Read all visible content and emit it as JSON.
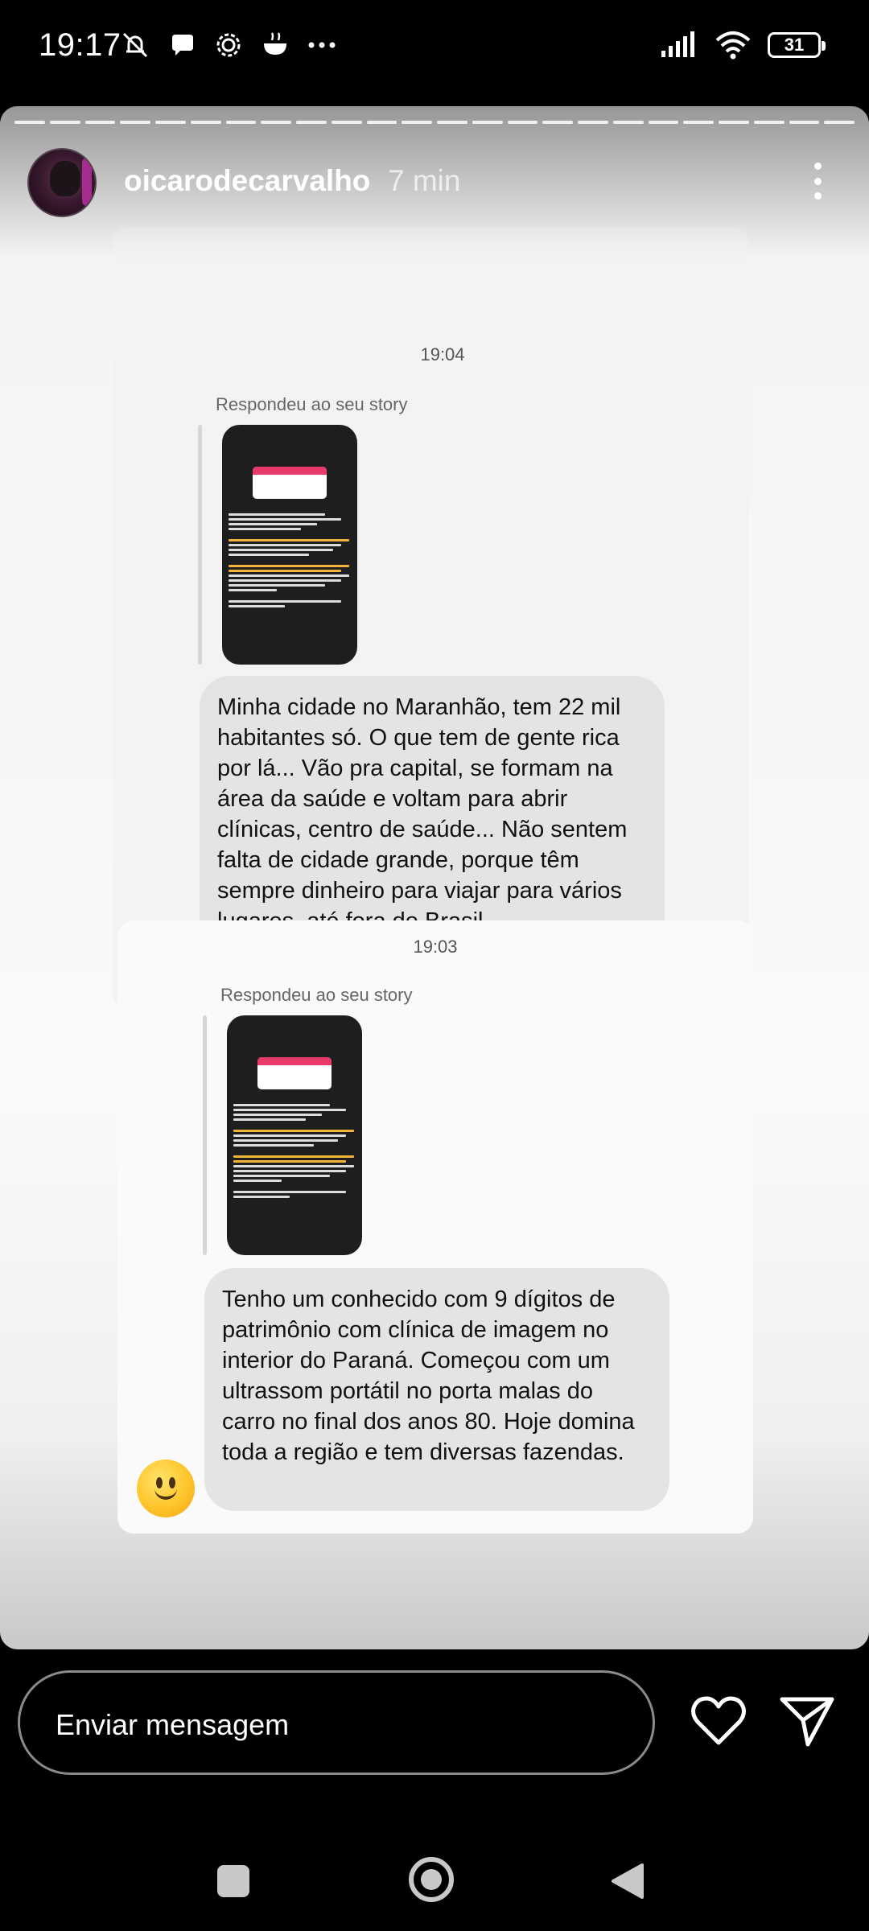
{
  "status_bar": {
    "time": "19:17",
    "battery": "31",
    "left_icons": [
      "mute-icon",
      "chat-icon",
      "settings-icon",
      "cooking-icon",
      "more-icon"
    ],
    "right_icons": [
      "signal-icon",
      "wifi-icon",
      "battery-icon"
    ]
  },
  "story": {
    "username": "oicarodecarvalho",
    "time_ago": "7 min",
    "progress_segments": 24
  },
  "messages": [
    {
      "time": "19:04",
      "replied_label": "Respondeu ao seu story",
      "text": "Minha cidade no Maranhão, tem 22 mil habitantes só. O que tem de gente rica por lá... Vão pra capital, se formam na área da saúde e voltam para abrir clínicas, centro de saúde... Não sentem falta de cidade grande, porque têm sempre dinheiro para viajar para vários lugares, até fora do Brasil."
    },
    {
      "time": "19:03",
      "replied_label": "Respondeu ao seu story",
      "text": "Tenho um conhecido com 9 dígitos de patrimônio com clínica de imagem no interior do Paraná. Começou com um ultrassom portátil no porta malas do carro no final dos anos 80. Hoje domina toda a região e tem diversas fazendas."
    }
  ],
  "composer": {
    "placeholder": "Enviar mensagem"
  },
  "colors": {
    "bubble": "#e4e4e4",
    "background": "#000000",
    "accent_pink": "#e83a6b"
  }
}
